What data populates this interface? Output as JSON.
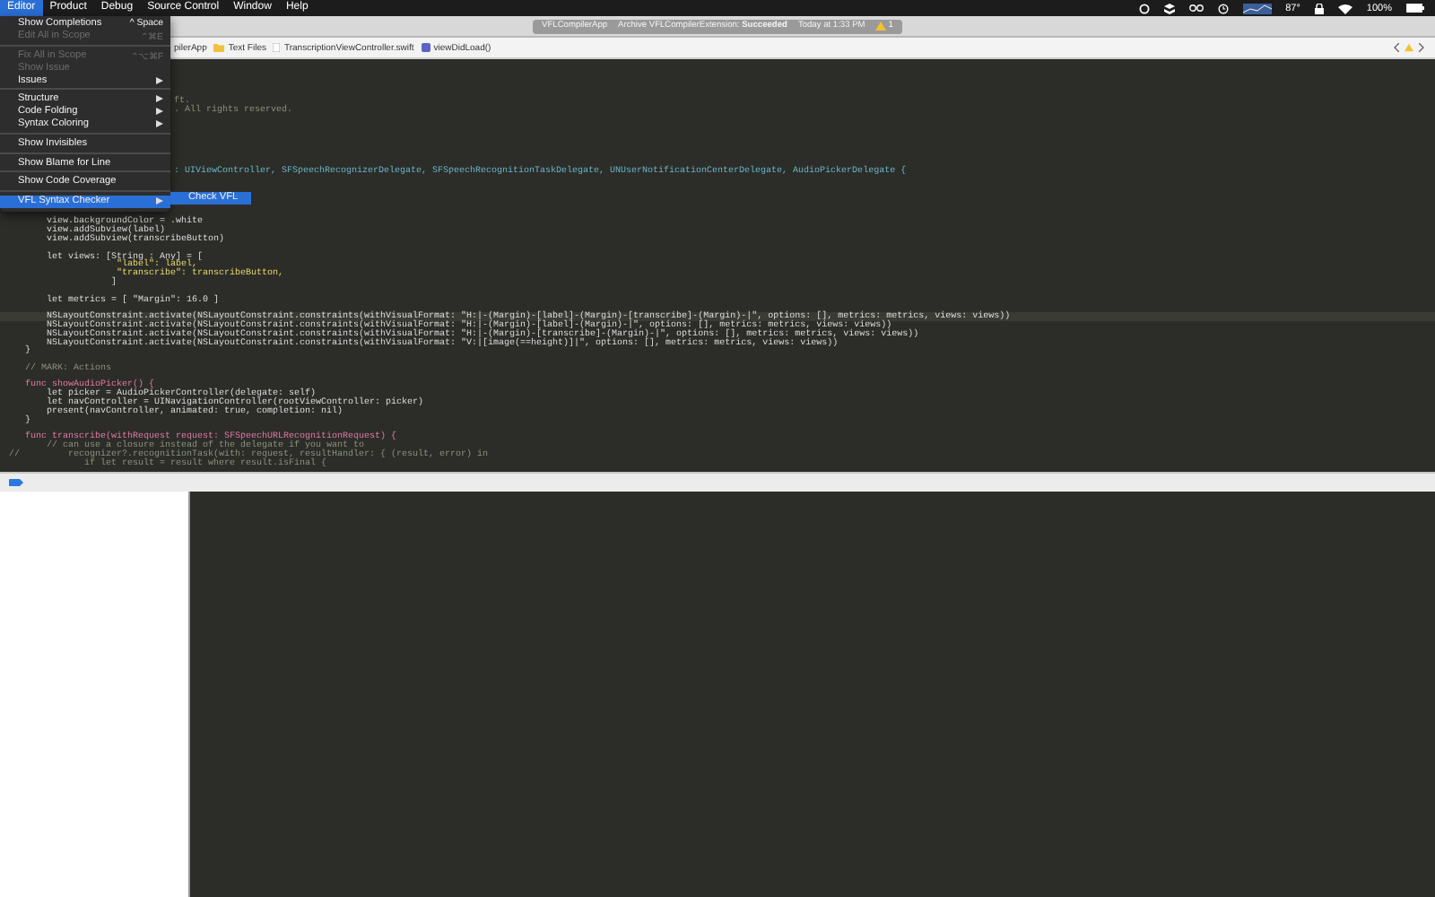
{
  "menu_bar": {
    "items": [
      {
        "label": "Editor",
        "selected": true
      },
      {
        "label": "Product",
        "selected": false
      },
      {
        "label": "Debug",
        "selected": false
      },
      {
        "label": "Source Control",
        "selected": false
      },
      {
        "label": "Window",
        "selected": false
      },
      {
        "label": "Help",
        "selected": false
      }
    ],
    "status": {
      "temperature": "87°",
      "battery": "100%"
    }
  },
  "activity": {
    "scheme": "VFLCompilerApp",
    "message": "Archive VFLCompilerExtension: **Succeeded**",
    "time": "Today at 1:33 PM",
    "warnings": "1"
  },
  "breadcrumb": [
    {
      "label": "pilerApp",
      "kind": "project"
    },
    {
      "label": "Text Files",
      "kind": "folder"
    },
    {
      "label": "TranscriptionViewController.swift",
      "kind": "file"
    },
    {
      "label": "viewDidLoad()",
      "kind": "method"
    }
  ],
  "editor_menu": [
    {
      "kind": "item",
      "label": "Show Completions",
      "shortcut": "^ Space",
      "disabled": false,
      "submenu": false,
      "selected": false
    },
    {
      "kind": "item",
      "label": "Edit All in Scope",
      "shortcut": "⌃⌘E",
      "disabled": true,
      "submenu": false,
      "selected": false
    },
    {
      "kind": "separator"
    },
    {
      "kind": "item",
      "label": "Fix All in Scope",
      "shortcut": "⌃⌥⌘F",
      "disabled": true,
      "submenu": false,
      "selected": false
    },
    {
      "kind": "item",
      "label": "Show Issue",
      "disabled": true,
      "submenu": false,
      "selected": false
    },
    {
      "kind": "item",
      "label": "Issues",
      "disabled": false,
      "submenu": true,
      "selected": false
    },
    {
      "kind": "separator"
    },
    {
      "kind": "item",
      "label": "Structure",
      "disabled": false,
      "submenu": true,
      "selected": false
    },
    {
      "kind": "item",
      "label": "Code Folding",
      "disabled": false,
      "submenu": true,
      "selected": false
    },
    {
      "kind": "item",
      "label": "Syntax Coloring",
      "disabled": false,
      "submenu": true,
      "selected": false
    },
    {
      "kind": "separator"
    },
    {
      "kind": "item",
      "label": "Show Invisibles",
      "disabled": false,
      "submenu": false,
      "selected": false
    },
    {
      "kind": "separator"
    },
    {
      "kind": "item",
      "label": "Show Blame for Line",
      "disabled": false,
      "submenu": false,
      "selected": false
    },
    {
      "kind": "separator"
    },
    {
      "kind": "item",
      "label": "Show Code Coverage",
      "disabled": false,
      "submenu": false,
      "selected": false
    },
    {
      "kind": "separator"
    },
    {
      "kind": "item",
      "label": "VFL Syntax Checker",
      "disabled": false,
      "submenu": true,
      "selected": true
    }
  ],
  "submenu": [
    {
      "label": "Check VFL",
      "selected": true
    }
  ],
  "code_lines": [
    {
      "kind": "blank"
    },
    {
      "kind": "blank"
    },
    {
      "kind": "blank"
    },
    {
      "kind": "blank"
    },
    {
      "kind": "comment",
      "covered": true,
      "current": false,
      "text": "ft."
    },
    {
      "kind": "comment",
      "covered": true,
      "current": false,
      "text": ". All rights reserved."
    },
    {
      "kind": "blank"
    },
    {
      "kind": "blank"
    },
    {
      "kind": "blank"
    },
    {
      "kind": "blank"
    },
    {
      "kind": "blank"
    },
    {
      "kind": "blank"
    },
    {
      "kind": "type",
      "covered": true,
      "current": false,
      "text": ": UIViewController, SFSpeechRecognizerDelegate, SFSpeechRecognitionTaskDelegate, UNUserNotificationCenterDelegate, AudioPickerDelegate {"
    },
    {
      "kind": "blank"
    },
    {
      "kind": "blank"
    },
    {
      "kind": "blank"
    },
    {
      "kind": "blank"
    },
    {
      "kind": "blank"
    },
    {
      "kind": "code",
      "covered": false,
      "current": false,
      "text": "       view.backgroundColor = .white"
    },
    {
      "kind": "code",
      "covered": false,
      "current": false,
      "text": "       view.addSubview(label)"
    },
    {
      "kind": "code",
      "covered": false,
      "current": false,
      "text": "       view.addSubview(transcribeButton)"
    },
    {
      "kind": "blank"
    },
    {
      "kind": "code",
      "covered": false,
      "current": false,
      "text": "       let views: [String : Any] = ["
    },
    {
      "kind": "string",
      "covered": false,
      "current": false,
      "text": "                    \"label\": label,"
    },
    {
      "kind": "string",
      "covered": false,
      "current": false,
      "text": "                    \"transcribe\": transcribeButton,"
    },
    {
      "kind": "code",
      "covered": false,
      "current": false,
      "text": "                   ]"
    },
    {
      "kind": "blank"
    },
    {
      "kind": "code",
      "covered": false,
      "current": false,
      "text": "       let metrics = [ \"Margin\": 16.0 ]"
    },
    {
      "kind": "blank"
    },
    {
      "kind": "code",
      "covered": false,
      "current": true,
      "text": "       NSLayoutConstraint.activate(NSLayoutConstraint.constraints(withVisualFormat: \"H:|-(Margin)-[label]-(Margin)-[transcribe]-(Margin)-|\", options: [], metrics: metrics, views: views))"
    },
    {
      "kind": "code",
      "covered": false,
      "current": false,
      "text": "       NSLayoutConstraint.activate(NSLayoutConstraint.constraints(withVisualFormat: \"H:|-(Margin)-[label]-(Margin)-|\", options: [], metrics: metrics, views: views))"
    },
    {
      "kind": "code",
      "covered": false,
      "current": false,
      "text": "       NSLayoutConstraint.activate(NSLayoutConstraint.constraints(withVisualFormat: \"H:|-(Margin)-[transcribe]-(Margin)-|\", options: [], metrics: metrics, views: views))"
    },
    {
      "kind": "code",
      "covered": false,
      "current": false,
      "text": "       NSLayoutConstraint.activate(NSLayoutConstraint.constraints(withVisualFormat: \"V:|[image(==height)]|\", options: [], metrics: metrics, views: views))"
    },
    {
      "kind": "code",
      "covered": false,
      "current": false,
      "text": "   }"
    },
    {
      "kind": "blank"
    },
    {
      "kind": "comment",
      "covered": false,
      "current": false,
      "text": "   // MARK: Actions"
    },
    {
      "kind": "blank"
    },
    {
      "kind": "keyword",
      "covered": false,
      "current": false,
      "text": "   func showAudioPicker() {"
    },
    {
      "kind": "code",
      "covered": false,
      "current": false,
      "text": "       let picker = AudioPickerController(delegate: self)"
    },
    {
      "kind": "code",
      "covered": false,
      "current": false,
      "text": "       let navController = UINavigationController(rootViewController: picker)"
    },
    {
      "kind": "code",
      "covered": false,
      "current": false,
      "text": "       present(navController, animated: true, completion: nil)"
    },
    {
      "kind": "code",
      "covered": false,
      "current": false,
      "text": "   }"
    },
    {
      "kind": "blank"
    },
    {
      "kind": "keyword",
      "covered": false,
      "current": false,
      "text": "   func transcribe(withRequest request: SFSpeechURLRecognitionRequest) {"
    },
    {
      "kind": "comment",
      "covered": false,
      "current": false,
      "text": "       // can use a closure instead of the delegate if you want to"
    },
    {
      "kind": "comment",
      "covered": false,
      "current": false,
      "text": "//         recognizer?.recognitionTask(with: request, resultHandler: { (result, error) in"
    },
    {
      "kind": "comment",
      "covered": false,
      "current": false,
      "text": "              if let result = result where result.isFinal {"
    }
  ]
}
